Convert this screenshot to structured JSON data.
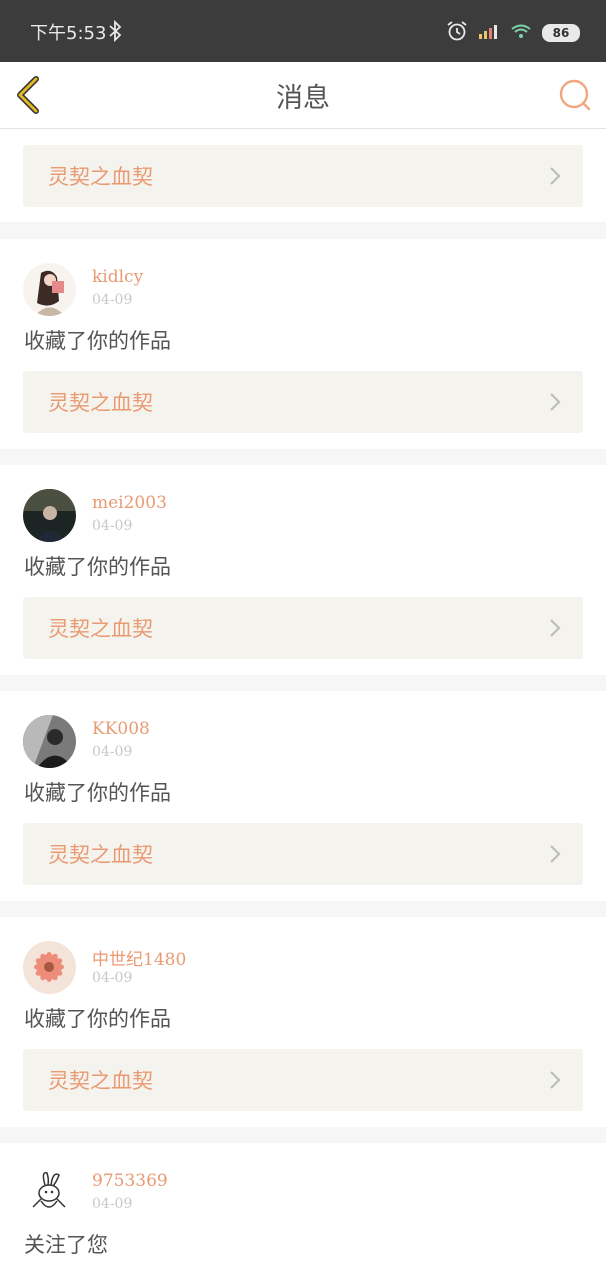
{
  "status_bar": {
    "time": "下午5:53",
    "battery": "86",
    "icons": [
      "bluetooth-icon",
      "alarm-icon",
      "signal-icon",
      "wifi-icon",
      "battery-icon"
    ]
  },
  "header": {
    "title": "消息",
    "back_icon": "chevron-left-icon",
    "search_icon": "search-icon"
  },
  "top_work": {
    "title": "灵契之血契"
  },
  "messages": [
    {
      "username": "kidlcy",
      "date": "04-09",
      "action": "收藏了你的作品",
      "work": "灵契之血契"
    },
    {
      "username": "mei2003",
      "date": "04-09",
      "action": "收藏了你的作品",
      "work": "灵契之血契"
    },
    {
      "username": "KK008",
      "date": "04-09",
      "action": "收藏了你的作品",
      "work": "灵契之血契"
    },
    {
      "username": "中世纪1480",
      "date": "04-09",
      "action": "收藏了你的作品",
      "work": "灵契之血契"
    },
    {
      "username": "9753369",
      "date": "04-09",
      "action": "关注了您"
    }
  ],
  "colors": {
    "accent": "#ea9a72",
    "status_bar": "#3c3c3c",
    "link_bg": "#f4f3ed",
    "back_icon": "#e2b924"
  }
}
